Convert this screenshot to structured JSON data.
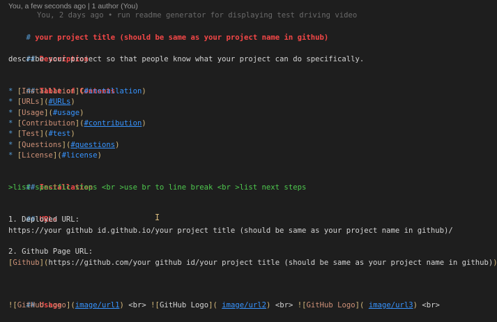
{
  "codelens": {
    "text": "You, a few seconds ago | 1 author (You)"
  },
  "blame": {
    "text": "You, 2 days ago • run readme generator for displaying test driving video"
  },
  "lines": {
    "l1": {
      "hash": "#",
      "title": "your project title (should be same as your project name in github)"
    },
    "l3": {
      "hash": "##",
      "title": "Description"
    },
    "l4": {
      "text": "describe your project so that people know what your project can do specifically."
    },
    "l6": {
      "hash": "##",
      "title": "Table of Contents"
    },
    "toc": [
      {
        "bullet": "*",
        "text": "Installation",
        "link": "#installation"
      },
      {
        "bullet": "*",
        "text": "URLs",
        "link": "#URLs"
      },
      {
        "bullet": "*",
        "text": "Usage",
        "link": "#usage"
      },
      {
        "bullet": "*",
        "text": "Contribution",
        "link": "#contribution"
      },
      {
        "bullet": "*",
        "text": "Test",
        "link": "#test"
      },
      {
        "bullet": "*",
        "text": "Questions",
        "link": "#questions"
      },
      {
        "bullet": "*",
        "text": "License",
        "link": "#license"
      }
    ],
    "l15": {
      "hash": "##",
      "title": "Installation"
    },
    "l16": {
      "text": ">list specific steps <br >use br to line break <br >list next steps"
    },
    "l18": {
      "hash": "##",
      "title": "URLs"
    },
    "l19": {
      "text": "1. Deployed URL:"
    },
    "l20": {
      "text": "https://your github id.github.io/your project title (should be same as your project name in github)/"
    },
    "l22": {
      "text": "2. Github Page URL:"
    },
    "l23": {
      "text": "Github",
      "url": "https://github.com/your github id/your project title (should be same as your project name in github)"
    },
    "l26": {
      "hash": "##",
      "title": "Usage"
    },
    "l27": {
      "img1_alt": "GitHub Logo",
      "img1_url": "image/url1",
      "br1": "<br>",
      "img2_alt": "GitHub Logo",
      "img2_url": "image/url2",
      "br2": "<br>",
      "img3_alt": "GitHub Logo",
      "img3_url": "image/url3",
      "br3": "<br>"
    }
  },
  "colors": {
    "background": "#1e1e1e",
    "heading_marker": "#569cd6",
    "heading_text": "#f44747",
    "link_text": "#ce9178",
    "link_url": "#3794ff",
    "indent_text": "#4ec94e"
  }
}
